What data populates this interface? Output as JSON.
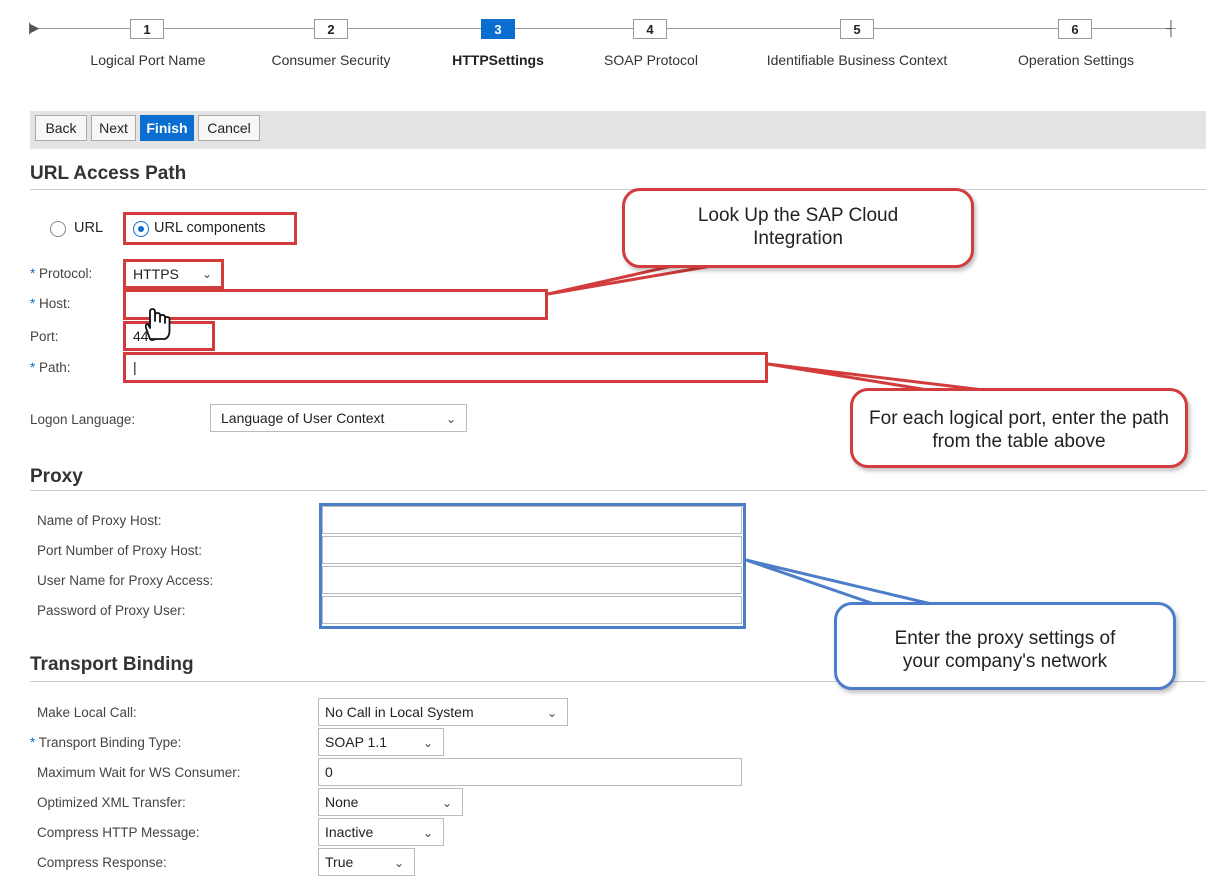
{
  "roadmap": {
    "steps": [
      {
        "number": "1",
        "label": "Logical Port Name"
      },
      {
        "number": "2",
        "label": "Consumer Security"
      },
      {
        "number": "3",
        "label": "HTTPSettings"
      },
      {
        "number": "4",
        "label": "SOAP Protocol"
      },
      {
        "number": "5",
        "label": "Identifiable Business Context"
      },
      {
        "number": "6",
        "label": "Operation Settings"
      }
    ],
    "active_step": 3
  },
  "toolbar": {
    "back": "Back",
    "next": "Next",
    "finish": "Finish",
    "cancel": "Cancel"
  },
  "url_access": {
    "title": "URL Access Path",
    "radio_url": "URL",
    "radio_components": "URL components",
    "selected": "URL components",
    "protocol_label": "Protocol:",
    "protocol_value": "HTTPS",
    "host_label": "Host:",
    "host_value": "",
    "port_label": "Port:",
    "port_value": "443",
    "path_label": "Path:",
    "path_value": "|",
    "logon_label": "Logon Language:",
    "logon_value": "Language of User Context"
  },
  "proxy": {
    "title": "Proxy",
    "fields": [
      {
        "label": "Name of Proxy Host:",
        "value": ""
      },
      {
        "label": "Port Number of Proxy Host:",
        "value": ""
      },
      {
        "label": "User Name for Proxy Access:",
        "value": ""
      },
      {
        "label": "Password of Proxy User:",
        "value": ""
      }
    ]
  },
  "transport": {
    "title": "Transport Binding",
    "local_call_label": "Make Local Call:",
    "local_call_value": "No Call in Local System",
    "binding_type_label": "Transport Binding Type:",
    "binding_type_value": "SOAP 1.1",
    "max_wait_label": "Maximum Wait for WS Consumer:",
    "max_wait_value": "0",
    "xml_transfer_label": "Optimized XML Transfer:",
    "xml_transfer_value": "None",
    "compress_http_label": "Compress HTTP Message:",
    "compress_http_value": "Inactive",
    "compress_resp_label": "Compress Response:",
    "compress_resp_value": "True"
  },
  "callouts": {
    "lookup": "Look Up the SAP Cloud Integration",
    "path": "For each logical port, enter the path from the table above",
    "proxy": "Enter the proxy settings of your company's network"
  },
  "colors": {
    "accent": "#0a6ed1",
    "highlight_red": "#d33c3c",
    "highlight_blue": "#4c7dc9"
  },
  "icons": [
    "roadmap-start-icon",
    "roadmap-end-icon",
    "hand-cursor-icon",
    "chevron-down-icon"
  ]
}
